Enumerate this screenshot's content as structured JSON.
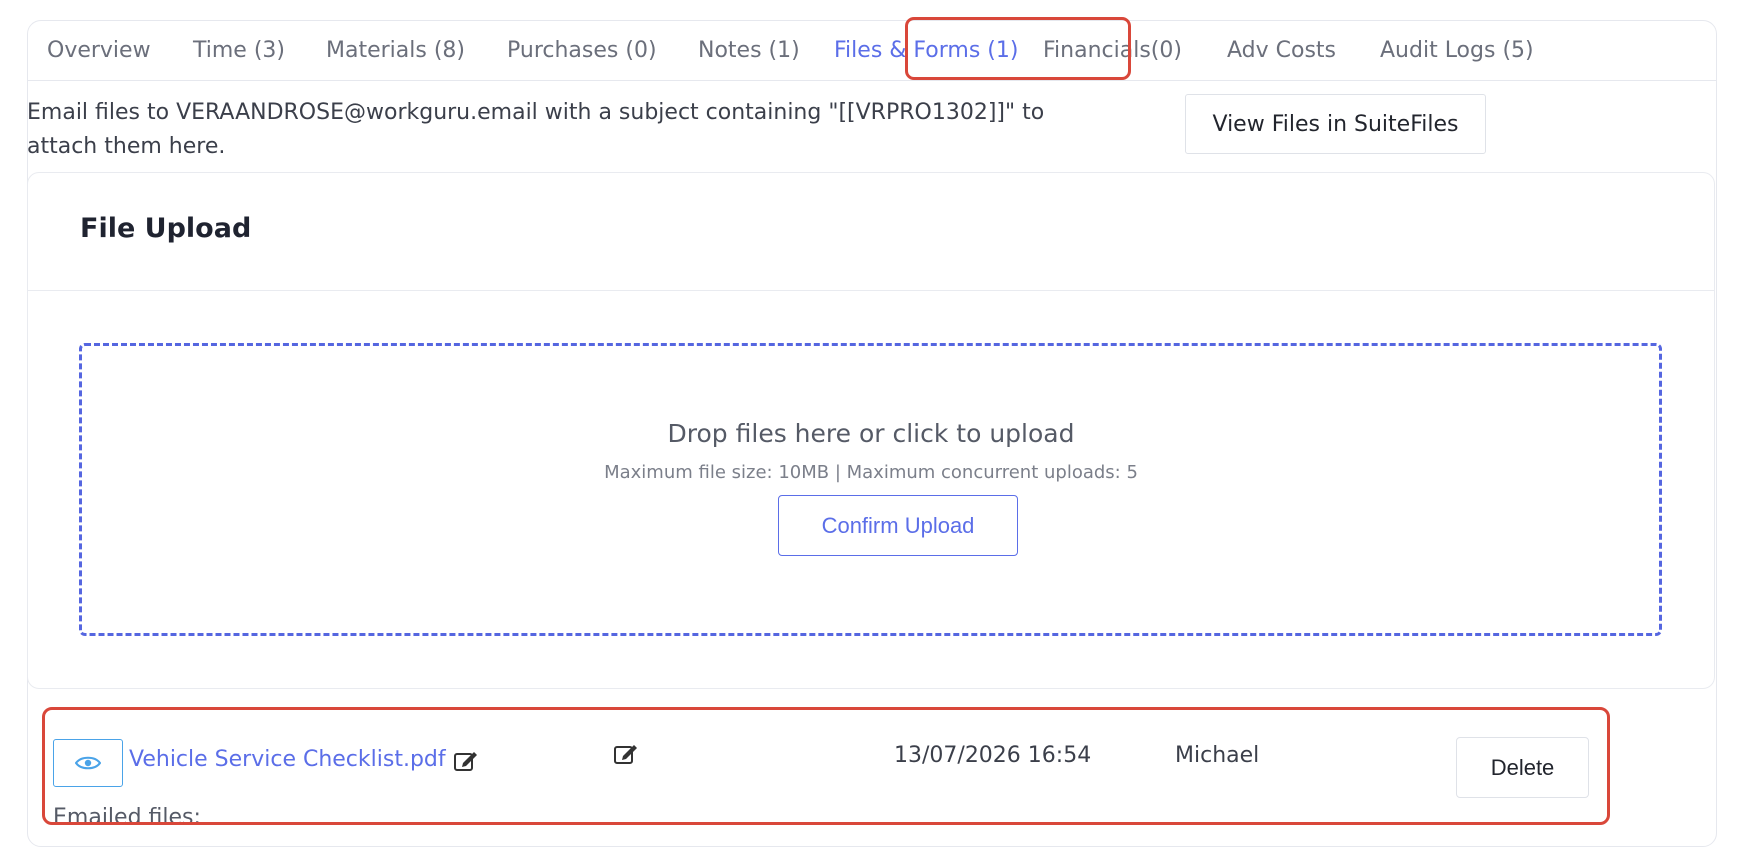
{
  "tabs": [
    {
      "label": "Overview"
    },
    {
      "label": "Time (3)"
    },
    {
      "label": "Materials (8)"
    },
    {
      "label": "Purchases (0)"
    },
    {
      "label": "Notes (1)"
    },
    {
      "label": "Files & Forms (1)",
      "active": true
    },
    {
      "label": "Financials(0)"
    },
    {
      "label": "Adv Costs"
    },
    {
      "label": "Audit Logs (5)"
    }
  ],
  "email_info": "Email files to VERAANDROSE@workguru.email with a subject containing \"[[VRPRO1302]]\" to attach them here.",
  "suitefiles_button": "View Files in SuiteFiles",
  "upload": {
    "title": "File Upload",
    "drop_text": "Drop files here or click to upload",
    "limits_text": "Maximum file size: 10MB | Maximum concurrent uploads: 5",
    "confirm_label": "Confirm Upload"
  },
  "file": {
    "name": "Vehicle Service Checklist.pdf",
    "date": "13/07/2026 16:54",
    "user": "Michael",
    "delete_label": "Delete"
  },
  "emailed_files_label": "Emailed files:",
  "colors": {
    "accent": "#5b6ee8",
    "highlight": "#d9473a",
    "eye_button_border": "#4aa3e8"
  }
}
